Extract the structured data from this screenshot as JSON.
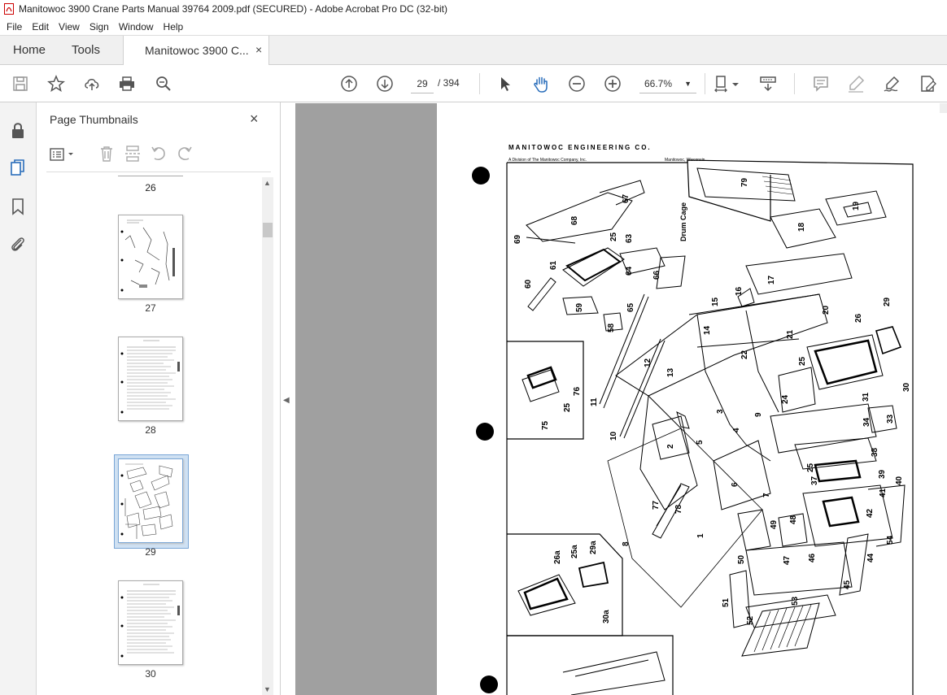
{
  "window": {
    "title": "Manitowoc 3900 Crane Parts Manual 39764 2009.pdf (SECURED) - Adobe Acrobat Pro DC (32-bit)"
  },
  "menu": [
    "File",
    "Edit",
    "View",
    "Sign",
    "Window",
    "Help"
  ],
  "tabs": {
    "home": "Home",
    "tools": "Tools",
    "document": "Manitowoc 3900 C...",
    "close": "×"
  },
  "toolbar": {
    "current_page": "29",
    "page_total": "/ 394",
    "zoom": "66.7%"
  },
  "thumbnails": {
    "title": "Page Thumbnails",
    "close": "×",
    "pages": [
      {
        "label": "26"
      },
      {
        "label": "27"
      },
      {
        "label": "28"
      },
      {
        "label": "29",
        "selected": true
      },
      {
        "label": "30"
      }
    ]
  },
  "document_page": {
    "header": "MANITOWOC ENGINEERING CO.",
    "subheader_left": "A Division of The Manitowoc Company, Inc.",
    "subheader_right": "Manitowoc, Wisconsin",
    "drum_cage_label": "Drum Cage",
    "part_numbers": [
      "79",
      "67",
      "68",
      "18",
      "19",
      "69",
      "25",
      "63",
      "61",
      "60",
      "64",
      "66",
      "16",
      "17",
      "59",
      "65",
      "58",
      "15",
      "14",
      "20",
      "29",
      "26",
      "21",
      "22",
      "25",
      "12",
      "13",
      "30",
      "76",
      "11",
      "24",
      "31",
      "3",
      "9",
      "34",
      "33",
      "75",
      "25",
      "10",
      "5",
      "2",
      "4",
      "38",
      "6",
      "39",
      "40",
      "7",
      "37",
      "25",
      "41",
      "77",
      "78",
      "49",
      "48",
      "42",
      "8",
      "1",
      "54",
      "50",
      "47",
      "46",
      "44",
      "26a",
      "25a",
      "29a",
      "45",
      "51",
      "53",
      "30a",
      "52"
    ]
  },
  "colors": {
    "viewer_bg": "#a0a0a0",
    "selected_thumb": "#cfe1f3",
    "accent_blue": "#2a6ebb"
  }
}
